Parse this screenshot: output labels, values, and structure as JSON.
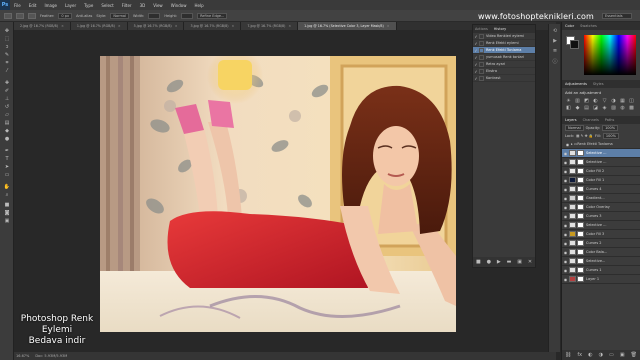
{
  "menubar": {
    "logo": "Ps",
    "items": [
      "File",
      "Edit",
      "Image",
      "Layer",
      "Type",
      "Select",
      "Filter",
      "3D",
      "View",
      "Window",
      "Help"
    ]
  },
  "options": {
    "items": [
      "Feather:",
      "0 px",
      "Anti-alias",
      "Style:",
      "Normal",
      "Width:",
      "Height:",
      "Refine Edge..."
    ],
    "workspace": "Essentials"
  },
  "watermark": "www.fotoshopteknikleri.com",
  "tabs": [
    {
      "label": "2.jpg @ 16.7% (RGB/8)",
      "active": false
    },
    {
      "label": "1.jpg @ 16.7% (RGB/8)",
      "active": false
    },
    {
      "label": "5.jpg @ 16.7% (RGB/8)",
      "active": false
    },
    {
      "label": "3.jpg @ 16.7% (RGB/8)",
      "active": false
    },
    {
      "label": "7.jpg @ 16.7% (RGB/8)",
      "active": false
    },
    {
      "label": "1.jpg @ 16.7% (Selective Color 3, Layer Mask/8)",
      "active": true
    }
  ],
  "actions_panel": {
    "tabs": [
      "Actions",
      "History"
    ],
    "rows": [
      {
        "label": "Video Renkleri eylemi",
        "checked": true,
        "selected": false
      },
      {
        "label": "Renk Efekti eylemi",
        "checked": true,
        "selected": false
      },
      {
        "label": "Renk Efekti Tonlama",
        "checked": true,
        "selected": true
      },
      {
        "label": "yumusak Renk tonlari",
        "checked": true,
        "selected": false
      },
      {
        "label": "Retro ayari",
        "checked": true,
        "selected": false
      },
      {
        "label": "Ekstra",
        "checked": true,
        "selected": false
      },
      {
        "label": "Kontrast",
        "checked": true,
        "selected": false
      }
    ],
    "footer_icons": [
      "■",
      "●",
      "▶",
      "▬",
      "▣",
      "✕"
    ]
  },
  "right": {
    "color_tabs": [
      "Color",
      "Swatches"
    ],
    "adjust_tabs": [
      "Adjustments",
      "Styles"
    ],
    "adjust_title": "Add an adjustment",
    "adjust_icons": [
      "☀",
      "▥",
      "◩",
      "◐",
      "▽",
      "◑",
      "▦",
      "◫",
      "◧",
      "◆",
      "▤",
      "◪",
      "◈",
      "▨",
      "◍",
      "▩"
    ],
    "layers_tabs": [
      "Layers",
      "Channels",
      "Paths"
    ],
    "blend_mode": "Normal",
    "opacity_label": "Opacity:",
    "opacity": "100%",
    "lock_label": "Lock:",
    "fill_label": "Fill:",
    "fill": "100%",
    "group_label": "Renk Efekti Tonlama",
    "layers": [
      {
        "name": "Selective ...",
        "thumb": "#e0e0e0",
        "sel": true
      },
      {
        "name": "Selective ...",
        "thumb": "#e0e0e0",
        "sel": false
      },
      {
        "name": "Color Fill 2",
        "thumb": "#e8e8e8",
        "sel": false
      },
      {
        "name": "Color Fill 1",
        "thumb": "#0e1a3a",
        "sel": false
      },
      {
        "name": "Curves 4",
        "thumb": "#e0e0e0",
        "sel": false
      },
      {
        "name": "Gradient...",
        "thumb": "#cfcfcf",
        "sel": false
      },
      {
        "name": "Color Overlay",
        "thumb": "#dcdcdc",
        "sel": false
      },
      {
        "name": "Curves 3",
        "thumb": "#e0e0e0",
        "sel": false
      },
      {
        "name": "Selective ...",
        "thumb": "#e0e0e0",
        "sel": false
      },
      {
        "name": "Color Fill 3",
        "thumb": "#c89a20",
        "sel": false
      },
      {
        "name": "Curves 2",
        "thumb": "#e0e0e0",
        "sel": false
      },
      {
        "name": "Color Bala...",
        "thumb": "#e0e0e0",
        "sel": false
      },
      {
        "name": "Selective...",
        "thumb": "#e0e0e0",
        "sel": false
      },
      {
        "name": "Curves 1",
        "thumb": "#e0e0e0",
        "sel": false
      },
      {
        "name": "Layer 1",
        "thumb": "#b44040",
        "sel": false
      }
    ],
    "footer_icons": [
      "⛓",
      "fx",
      "◐",
      "◑",
      "▭",
      "▣",
      "🗑"
    ]
  },
  "status": {
    "zoom": "16.67%",
    "doc": "Doc: 5.93M/5.93M"
  },
  "overlay": {
    "line1": "Photoshop Renk",
    "line2": "Eylemi",
    "line3": "Bedava indir"
  },
  "colors": {
    "accent": "#5d7fa8",
    "dress": "#d21f2c",
    "wallpaper": "#efd9b4"
  }
}
